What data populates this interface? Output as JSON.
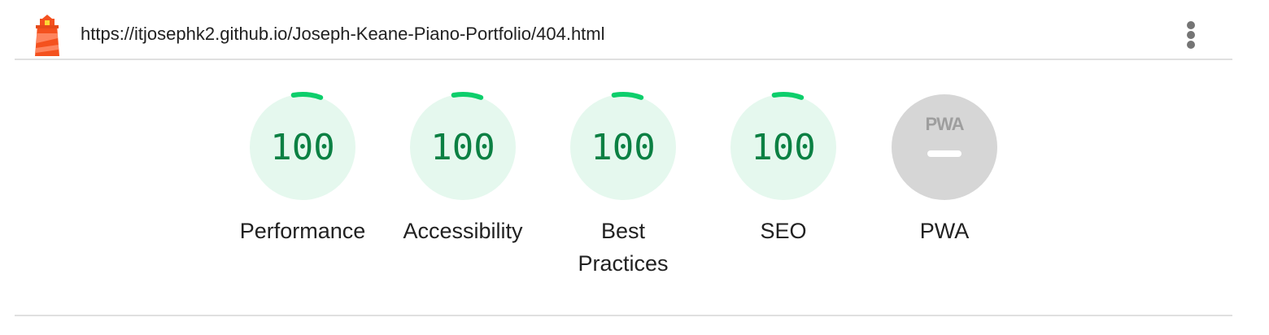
{
  "header": {
    "url": "https://itjosephk2.github.io/Joseph-Keane-Piano-Portfolio/404.html",
    "logo_icon": "lighthouse-icon",
    "menu_icon": "vertical-dots-icon"
  },
  "gauges": [
    {
      "label": "Performance",
      "score": "100",
      "fraction": 1.0,
      "color": "#0cce6b",
      "fill": "#e5f8ee"
    },
    {
      "label": "Accessibility",
      "score": "100",
      "fraction": 1.0,
      "color": "#0cce6b",
      "fill": "#e5f8ee"
    },
    {
      "label": "Best\nPractices",
      "score": "100",
      "fraction": 1.0,
      "color": "#0cce6b",
      "fill": "#e5f8ee"
    },
    {
      "label": "SEO",
      "score": "100",
      "fraction": 1.0,
      "color": "#0cce6b",
      "fill": "#e5f8ee"
    }
  ],
  "pwa": {
    "label": "PWA",
    "badge_text": "PWA",
    "score": "—",
    "fill": "#d6d6d6"
  }
}
